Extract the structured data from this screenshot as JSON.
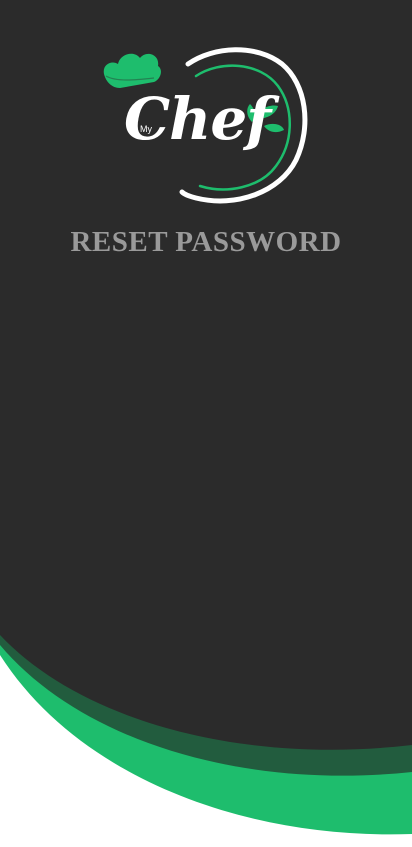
{
  "app": {
    "logo_prefix": "My",
    "logo_name": "Chef"
  },
  "screen": {
    "title": "RESET PASSWORD"
  },
  "colors": {
    "background_dark": "#2b2b2b",
    "accent_green": "#1ebd6d",
    "dark_green": "#225c3e",
    "title_gray": "#9a9a9a",
    "white": "#ffffff"
  },
  "icons": {
    "chef_hat": "chef-hat-icon",
    "leaves": "leaf-icon"
  }
}
